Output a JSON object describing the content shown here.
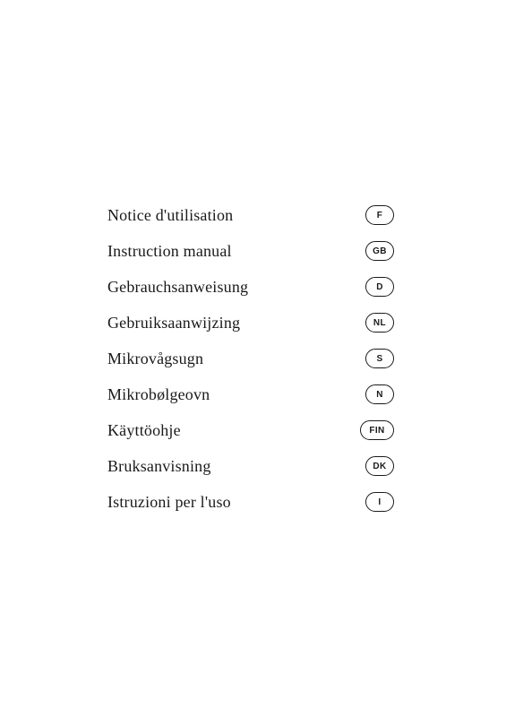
{
  "items": [
    {
      "label": "Notice d'utilisation",
      "badge": "F",
      "wide": false
    },
    {
      "label": "Instruction manual",
      "badge": "GB",
      "wide": false
    },
    {
      "label": "Gebrauchsanweisung",
      "badge": "D",
      "wide": false
    },
    {
      "label": "Gebruiksaanwijzing",
      "badge": "NL",
      "wide": false
    },
    {
      "label": "Mikrovågsugn",
      "badge": "S",
      "wide": false
    },
    {
      "label": "Mikrobølgeovn",
      "badge": "N",
      "wide": false
    },
    {
      "label": "Käyttöohje",
      "badge": "FIN",
      "wide": true
    },
    {
      "label": "Bruksanvisning",
      "badge": "DK",
      "wide": false
    },
    {
      "label": "Istruzioni per l'uso",
      "badge": "I",
      "wide": false
    }
  ]
}
